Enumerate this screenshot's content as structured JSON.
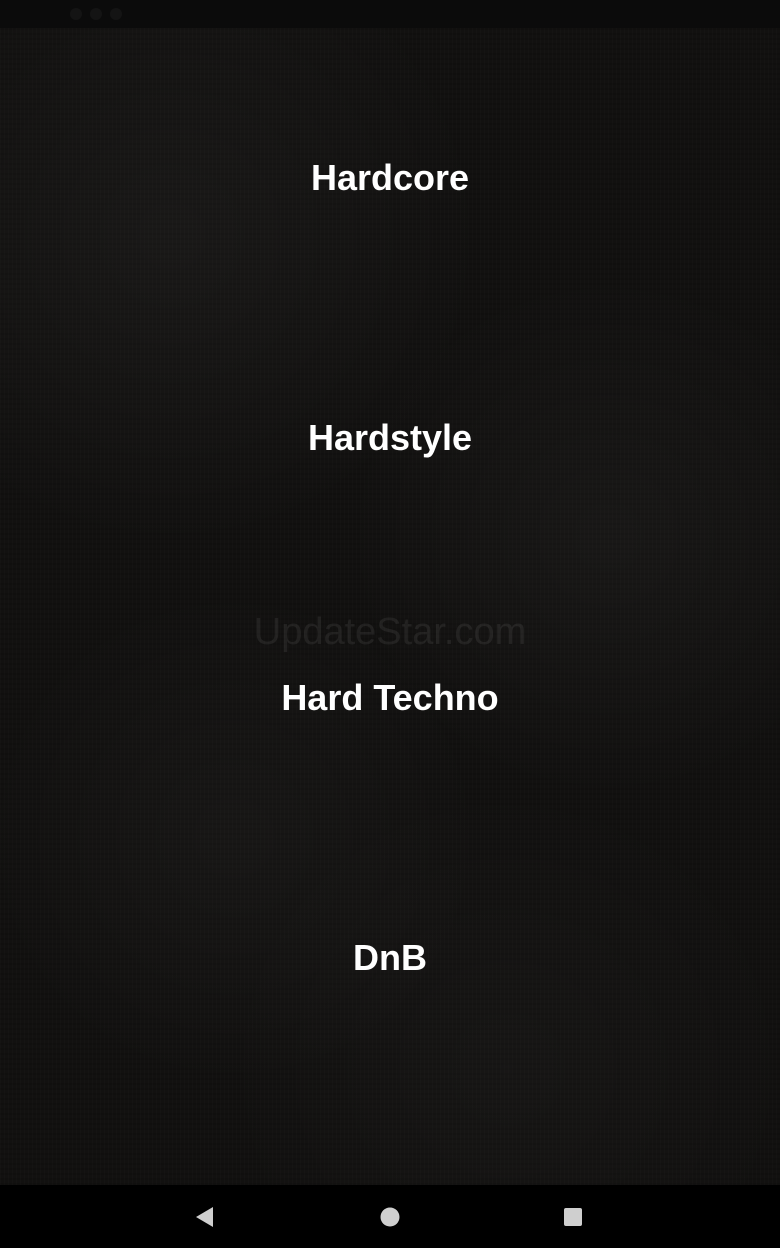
{
  "genres": {
    "items": [
      {
        "label": "Hardcore"
      },
      {
        "label": "Hardstyle"
      },
      {
        "label": "Hard Techno"
      },
      {
        "label": "DnB"
      }
    ]
  },
  "watermark": {
    "text": "UpdateStar.com"
  },
  "navigation": {
    "back_icon": "back-triangle-icon",
    "home_icon": "home-circle-icon",
    "recents_icon": "recents-square-icon"
  },
  "colors": {
    "background": "#121110",
    "text": "#ffffff",
    "nav_bar": "#000000",
    "nav_icons": "#cfcfcf"
  }
}
